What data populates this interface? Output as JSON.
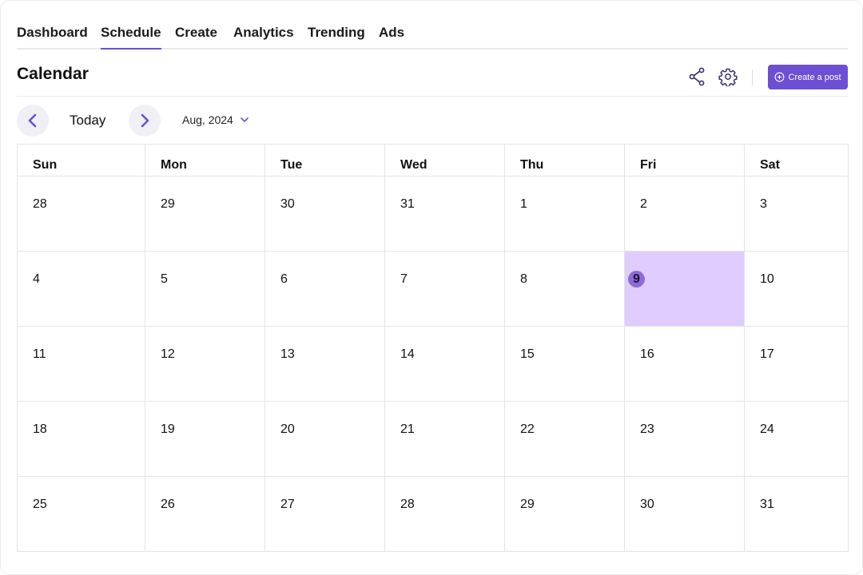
{
  "nav": {
    "tabs": [
      {
        "label": "Dashboard"
      },
      {
        "label": "Schedule",
        "active": true
      },
      {
        "label": "Create"
      },
      {
        "label": "Analytics"
      },
      {
        "label": "Trending"
      },
      {
        "label": "Ads"
      }
    ]
  },
  "header": {
    "title": "Calendar",
    "share_icon": "share-icon",
    "settings_icon": "gear-icon",
    "create_button_label": "Create a post",
    "create_button_icon": "plus-circle-icon"
  },
  "toolbar": {
    "prev_icon": "chevron-left-icon",
    "next_icon": "chevron-right-icon",
    "today_label": "Today",
    "month_label": "Aug, 2024",
    "month_dropdown_icon": "chevron-down-icon"
  },
  "calendar": {
    "weekdays": [
      "Sun",
      "Mon",
      "Tue",
      "Wed",
      "Thu",
      "Fri",
      "Sat"
    ],
    "weeks": [
      [
        "28",
        "29",
        "30",
        "31",
        "1",
        "2",
        "3"
      ],
      [
        "4",
        "5",
        "6",
        "7",
        "8",
        "9",
        "10"
      ],
      [
        "11",
        "12",
        "13",
        "14",
        "15",
        "16",
        "17"
      ],
      [
        "18",
        "19",
        "20",
        "21",
        "22",
        "23",
        "24"
      ],
      [
        "25",
        "26",
        "27",
        "28",
        "29",
        "30",
        "31"
      ]
    ],
    "selected_day": "9"
  },
  "colors": {
    "accent": "#6c4fd3",
    "selected_cell": "#e0ccff",
    "selected_badge": "#8e6bd8",
    "button_bg": "#f1eff6"
  }
}
